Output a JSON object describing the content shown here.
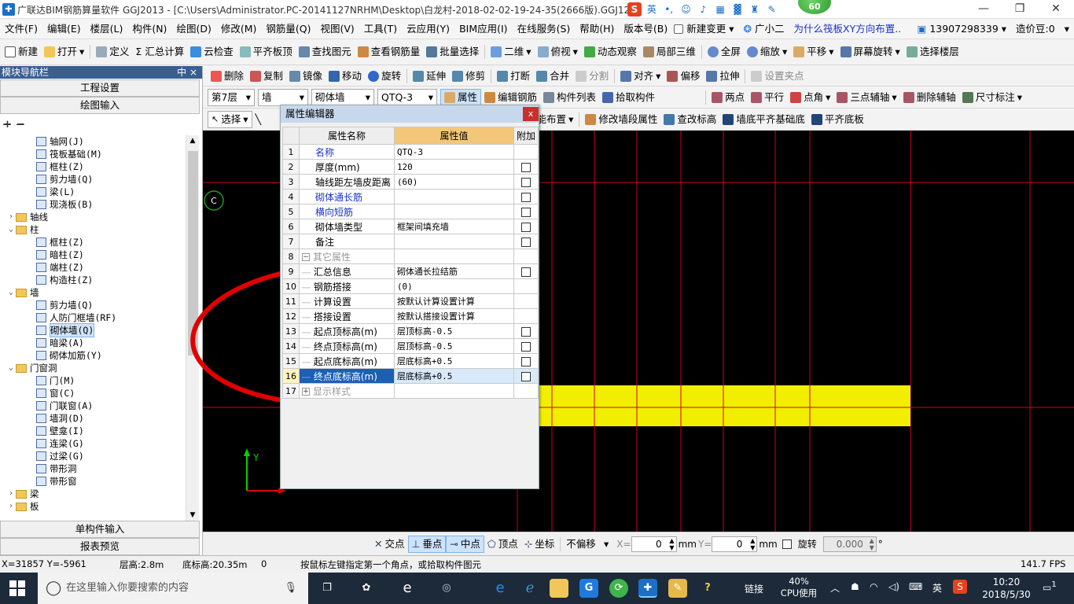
{
  "titlebar": {
    "title": "广联达BIM钢筋算量软件 GGJ2013 - [C:\\Users\\Administrator.PC-20141127NRHM\\Desktop\\白龙村-2018-02-02-19-24-35(2666版).GGJ12]",
    "badge": "60",
    "ime": "英"
  },
  "menu": [
    "文件(F)",
    "编辑(E)",
    "楼层(L)",
    "构件(N)",
    "绘图(D)",
    "修改(M)",
    "钢筋量(Q)",
    "视图(V)",
    "工具(T)",
    "云应用(Y)",
    "BIM应用(I)",
    "在线服务(S)",
    "帮助(H)",
    "版本号(B)",
    "新建变更",
    "广小二",
    "为什么筏板XY方向布置..",
    "13907298339",
    "造价豆:0"
  ],
  "toolbar1": [
    "新建",
    "打开",
    "定义",
    "Σ 汇总计算",
    "云检查",
    "平齐板顶",
    "查找图元",
    "查看钢筋量",
    "批量选择",
    "二维",
    "俯视",
    "动态观察",
    "局部三维",
    "全屏",
    "缩放",
    "平移",
    "屏幕旋转",
    "选择楼层"
  ],
  "toolbar2": [
    "删除",
    "复制",
    "镜像",
    "移动",
    "旋转",
    "延伸",
    "修剪",
    "打断",
    "合并",
    "分割",
    "对齐",
    "偏移",
    "拉伸",
    "设置夹点"
  ],
  "toolbar3": {
    "floor": "第7层",
    "type": "墙",
    "subtype": "砌体墙",
    "component": "QTQ-3",
    "items": [
      "属性",
      "编辑钢筋",
      "构件列表",
      "拾取构件",
      "两点",
      "平行",
      "点角",
      "三点辅轴",
      "删除辅轴",
      "尺寸标注"
    ]
  },
  "toolbar4": [
    "选择",
    "智能布置",
    "修改墙段属性",
    "查改标高",
    "墙底平齐基础底",
    "平齐底板"
  ],
  "leftpanel": {
    "header": "模块导航栏",
    "pin": "中 ×",
    "btn_project": "工程设置",
    "btn_draw": "绘图输入",
    "btn_single": "单构件输入",
    "btn_report": "报表预览",
    "tree": [
      {
        "label": "轴网(J)",
        "level": 2,
        "kind": "item"
      },
      {
        "label": "筏板基础(M)",
        "level": 2,
        "kind": "item"
      },
      {
        "label": "框柱(Z)",
        "level": 2,
        "kind": "item"
      },
      {
        "label": "剪力墙(Q)",
        "level": 2,
        "kind": "item"
      },
      {
        "label": "梁(L)",
        "level": 2,
        "kind": "item"
      },
      {
        "label": "现浇板(B)",
        "level": 2,
        "kind": "item"
      },
      {
        "label": "轴线",
        "level": 1,
        "kind": "folder",
        "exp": "›"
      },
      {
        "label": "柱",
        "level": 1,
        "kind": "folder",
        "exp": "⌄"
      },
      {
        "label": "框柱(Z)",
        "level": 2,
        "kind": "item"
      },
      {
        "label": "暗柱(Z)",
        "level": 2,
        "kind": "item"
      },
      {
        "label": "端柱(Z)",
        "level": 2,
        "kind": "item"
      },
      {
        "label": "构造柱(Z)",
        "level": 2,
        "kind": "item"
      },
      {
        "label": "墙",
        "level": 1,
        "kind": "folder",
        "exp": "⌄"
      },
      {
        "label": "剪力墙(Q)",
        "level": 2,
        "kind": "item"
      },
      {
        "label": "人防门框墙(RF)",
        "level": 2,
        "kind": "item"
      },
      {
        "label": "砌体墙(Q)",
        "level": 2,
        "kind": "item",
        "selected": true
      },
      {
        "label": "暗梁(A)",
        "level": 2,
        "kind": "item"
      },
      {
        "label": "砌体加筋(Y)",
        "level": 2,
        "kind": "item"
      },
      {
        "label": "门窗洞",
        "level": 1,
        "kind": "folder",
        "exp": "⌄"
      },
      {
        "label": "门(M)",
        "level": 2,
        "kind": "item"
      },
      {
        "label": "窗(C)",
        "level": 2,
        "kind": "item"
      },
      {
        "label": "门联窗(A)",
        "level": 2,
        "kind": "item"
      },
      {
        "label": "墙洞(D)",
        "level": 2,
        "kind": "item"
      },
      {
        "label": "壁龛(I)",
        "level": 2,
        "kind": "item"
      },
      {
        "label": "连梁(G)",
        "level": 2,
        "kind": "item"
      },
      {
        "label": "过梁(G)",
        "level": 2,
        "kind": "item"
      },
      {
        "label": "带形洞",
        "level": 2,
        "kind": "item"
      },
      {
        "label": "带形窗",
        "level": 2,
        "kind": "item"
      },
      {
        "label": "梁",
        "level": 1,
        "kind": "folder",
        "exp": "›"
      },
      {
        "label": "板",
        "level": 1,
        "kind": "folder",
        "exp": "›"
      }
    ]
  },
  "dialog": {
    "title": "属性编辑器",
    "close": "x",
    "headers": [
      "属性名称",
      "属性值",
      "附加"
    ],
    "rows": [
      {
        "n": "1",
        "name": "名称",
        "value": "QTQ-3",
        "check": false,
        "style": "blue"
      },
      {
        "n": "2",
        "name": "厚度(mm)",
        "value": "120",
        "check": true,
        "style": ""
      },
      {
        "n": "3",
        "name": "轴线距左墙皮距离",
        "value": "(60)",
        "check": true,
        "style": ""
      },
      {
        "n": "4",
        "name": "砌体通长筋",
        "value": "",
        "check": true,
        "style": "blue"
      },
      {
        "n": "5",
        "name": "横向短筋",
        "value": "",
        "check": true,
        "style": "blue"
      },
      {
        "n": "6",
        "name": "砌体墙类型",
        "value": "框架间填充墙",
        "check": true,
        "style": ""
      },
      {
        "n": "7",
        "name": "备注",
        "value": "",
        "check": true,
        "style": ""
      },
      {
        "n": "8",
        "name": "其它属性",
        "value": "",
        "check": false,
        "style": "group"
      },
      {
        "n": "9",
        "name": "汇总信息",
        "value": "砌体通长拉结筋",
        "check": true,
        "style": "child"
      },
      {
        "n": "10",
        "name": "钢筋搭接",
        "value": "(0)",
        "check": false,
        "style": "child"
      },
      {
        "n": "11",
        "name": "计算设置",
        "value": "按默认计算设置计算",
        "check": false,
        "style": "child"
      },
      {
        "n": "12",
        "name": "搭接设置",
        "value": "按默认搭接设置计算",
        "check": false,
        "style": "child"
      },
      {
        "n": "13",
        "name": "起点顶标高(m)",
        "value": "层顶标高-0.5",
        "check": true,
        "style": "child"
      },
      {
        "n": "14",
        "name": "终点顶标高(m)",
        "value": "层顶标高-0.5",
        "check": true,
        "style": "child"
      },
      {
        "n": "15",
        "name": "起点底标高(m)",
        "value": "层底标高+0.5",
        "check": true,
        "style": "child"
      },
      {
        "n": "16",
        "name": "终点底标高(m)",
        "value": "层底标高+0.5",
        "check": true,
        "style": "childsel"
      },
      {
        "n": "17",
        "name": "显示样式",
        "value": "",
        "check": false,
        "style": "group2"
      }
    ]
  },
  "canvas": {
    "marker": "C",
    "axis_label": "Y",
    "bg": "#000000",
    "grid_color": "#d0001c",
    "wall_color": "#f2ee00",
    "annotation_color": "#e00000"
  },
  "snapbar": {
    "items": [
      "交点",
      "垂点",
      "中点",
      "顶点",
      "坐标"
    ],
    "offset": "不偏移",
    "x_label": "X=",
    "x_value": "0",
    "y_label": "Y=",
    "y_value": "0",
    "unit": "mm",
    "rotate_label": "旋转",
    "rotate_value": "0.000",
    "deg": "°"
  },
  "status": {
    "coords": "X=31857 Y=-5961",
    "floor_h": "层高:2.8m",
    "base_h": "底标高:20.35m",
    "zero": "0",
    "hint": "按鼠标左键指定第一个角点，或拾取构件图元",
    "fps": "141.7 FPS"
  },
  "taskbar": {
    "search_placeholder": "在这里输入你要搜索的内容",
    "link": "链接",
    "cpu_pct": "40%",
    "cpu_label": "CPU使用",
    "ime": "英",
    "time": "10:20",
    "date": "2018/5/30",
    "notif": "1"
  }
}
